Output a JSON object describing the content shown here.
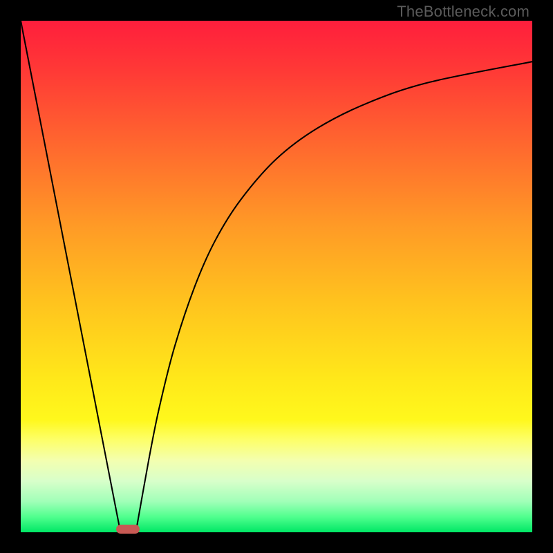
{
  "watermark": "TheBottleneck.com",
  "colors": {
    "frame": "#000000",
    "curve": "#000000",
    "marker": "#c85a54",
    "gradient_stops": [
      {
        "offset": 0.0,
        "color": "#ff1e3c"
      },
      {
        "offset": 0.1,
        "color": "#ff3a36"
      },
      {
        "offset": 0.25,
        "color": "#ff6a2e"
      },
      {
        "offset": 0.4,
        "color": "#ff9a26"
      },
      {
        "offset": 0.55,
        "color": "#ffc31e"
      },
      {
        "offset": 0.7,
        "color": "#ffe81a"
      },
      {
        "offset": 0.78,
        "color": "#fff81c"
      },
      {
        "offset": 0.82,
        "color": "#fdff6a"
      },
      {
        "offset": 0.86,
        "color": "#f3ffb0"
      },
      {
        "offset": 0.9,
        "color": "#d8ffca"
      },
      {
        "offset": 0.94,
        "color": "#a0ffb8"
      },
      {
        "offset": 0.97,
        "color": "#50ff8e"
      },
      {
        "offset": 1.0,
        "color": "#00e765"
      }
    ]
  },
  "chart_data": {
    "type": "line",
    "title": "",
    "xlabel": "",
    "ylabel": "",
    "xlim": [
      0,
      100
    ],
    "ylim": [
      0,
      100
    ],
    "grid": false,
    "legend": false,
    "series": [
      {
        "name": "left-line",
        "x": [
          0,
          19.5
        ],
        "values": [
          100,
          0
        ]
      },
      {
        "name": "right-curve",
        "x": [
          22.5,
          25,
          27,
          30,
          34,
          38,
          43,
          50,
          58,
          68,
          80,
          100
        ],
        "values": [
          0,
          14,
          24,
          36,
          48,
          57,
          65,
          73,
          79,
          84,
          88,
          92
        ]
      }
    ],
    "annotations": [
      {
        "name": "bottleneck-marker",
        "shape": "rounded-rect",
        "x_center": 21,
        "y_center": 0.6,
        "width": 4.6,
        "height": 1.7,
        "color": "#c85a54"
      }
    ]
  }
}
